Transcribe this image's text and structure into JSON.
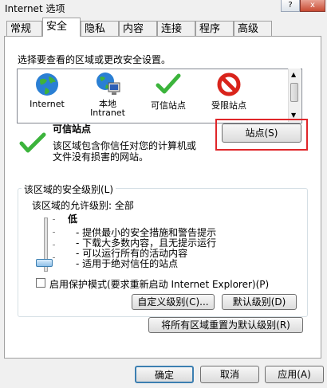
{
  "window": {
    "title": "Internet 选项",
    "help": "?",
    "close": "x"
  },
  "tabs": [
    {
      "label": "常规"
    },
    {
      "label": "安全"
    },
    {
      "label": "隐私"
    },
    {
      "label": "内容"
    },
    {
      "label": "连接"
    },
    {
      "label": "程序"
    },
    {
      "label": "高级"
    }
  ],
  "security": {
    "instruction": "选择要查看的区域或更改安全设置。",
    "zones": [
      {
        "label1": "Internet",
        "label2": "",
        "icon": "globe-icon"
      },
      {
        "label1": "本地",
        "label2": "Intranet",
        "icon": "local-intranet-icon"
      },
      {
        "label1": "可信站点",
        "label2": "",
        "icon": "checkmark-icon"
      },
      {
        "label1": "受限站点",
        "label2": "",
        "icon": "restricted-icon"
      }
    ],
    "zone_title": "可信站点",
    "zone_desc_1": "该区域包含你信任对您的计算机或",
    "zone_desc_2": "文件没有损害的网站。",
    "sites_button": "站点(S)",
    "level_group": "该区域的安全级别(L)",
    "allowed_level": "该区域的允许级别: 全部",
    "level_name": "低",
    "level_items": [
      "- 提供最小的安全措施和警告提示",
      "- 下载大多数内容，且无提示运行",
      "- 可以运行所有的活动内容",
      "- 适用于绝对信任的站点"
    ],
    "slider_level": 0,
    "protected_mode": "启用保护模式(要求重新启动 Internet Explorer)(P)",
    "custom_level": "自定义级别(C)...",
    "default_level": "默认级别(D)",
    "reset_all": "将所有区域重置为默认级别(R)"
  },
  "footer": {
    "ok": "确定",
    "cancel": "取消",
    "apply": "应用(A)"
  },
  "colors": {
    "highlight_box": "#e0262a"
  }
}
